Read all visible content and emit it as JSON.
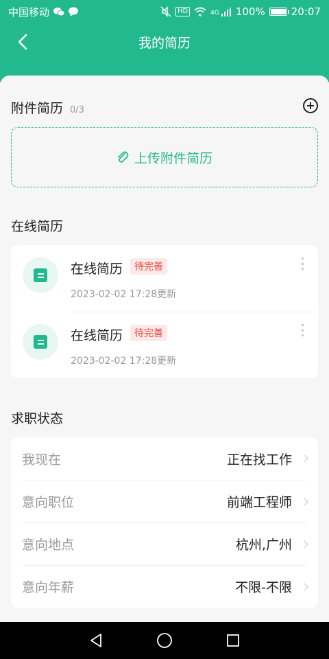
{
  "statusbar": {
    "carrier": "中国移动",
    "hd": "HD",
    "network": "4G",
    "battery_text": "100%",
    "battery_level": 1.0,
    "time": "20:07"
  },
  "header": {
    "title": "我的简历"
  },
  "attachment": {
    "title": "附件简历",
    "count": "0/3",
    "upload_label": "上传附件简历"
  },
  "online": {
    "title": "在线简历",
    "items": [
      {
        "name": "在线简历",
        "badge": "待完善",
        "updated": "2023-02-02 17:28更新"
      },
      {
        "name": "在线简历",
        "badge": "待完善",
        "updated": "2023-02-02 17:28更新"
      }
    ]
  },
  "job_status": {
    "title": "求职状态",
    "rows": [
      {
        "label": "我现在",
        "value": "正在找工作"
      },
      {
        "label": "意向职位",
        "value": "前端工程师"
      },
      {
        "label": "意向地点",
        "value": "杭州,广州"
      },
      {
        "label": "意向年薪",
        "value": "不限-不限"
      }
    ]
  },
  "colors": {
    "brand": "#22b98f",
    "badge_text": "#e8483f",
    "badge_bg": "#fde9e8"
  },
  "icons": {
    "back": "chevron-left-icon",
    "add": "add-circle-icon",
    "upload": "paperclip-icon",
    "doc": "document-icon",
    "more": "more-vertical-icon",
    "arrow": "chevron-right-icon"
  }
}
